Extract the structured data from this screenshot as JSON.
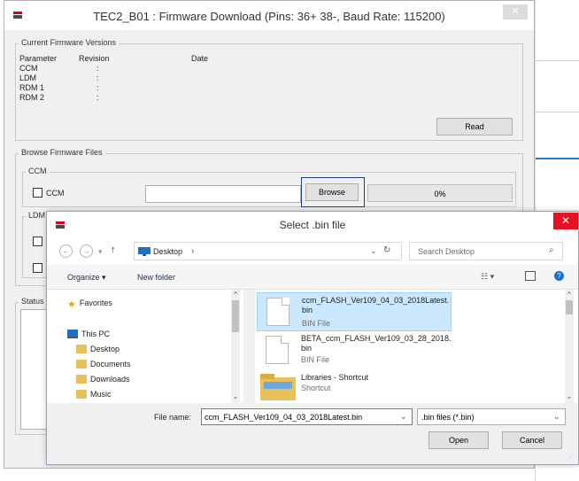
{
  "main_window": {
    "title": "TEC2_B01 : Firmware Download (Pins: 36+ 38-, Baud Rate: 115200)",
    "current_versions": {
      "legend": "Current Firmware Versions",
      "header": {
        "parameter": "Parameter",
        "revision": "Revision",
        "date": "Date"
      },
      "rows": [
        {
          "name": "CCM",
          "sep": ":"
        },
        {
          "name": "LDM",
          "sep": ":"
        },
        {
          "name": "RDM 1",
          "sep": ":"
        },
        {
          "name": "RDM 2",
          "sep": ":"
        }
      ],
      "read_button": "Read"
    },
    "browse": {
      "legend": "Browse Firmware Files",
      "ccm_legend": "CCM",
      "ccm_checkbox_label": "CCM",
      "browse_button": "Browse",
      "progress_text": "0%",
      "progress_fraction": 0,
      "ldm_legend": "LDM"
    },
    "status_legend": "Status"
  },
  "file_dialog": {
    "title": "Select .bin file",
    "close_glyph": "✕",
    "breadcrumb": "Desktop",
    "breadcrumb_sep": "›",
    "search_placeholder": "Search Desktop",
    "toolbar": {
      "organize": "Organize ▾",
      "new_folder": "New folder"
    },
    "nav_items": [
      {
        "label": "Favorites",
        "icon": "star-icon"
      },
      {
        "label": "This PC",
        "icon": "pc-icon"
      },
      {
        "label": "Desktop",
        "icon": "desktop-folder-icon"
      },
      {
        "label": "Documents",
        "icon": "documents-folder-icon"
      },
      {
        "label": "Downloads",
        "icon": "downloads-folder-icon"
      },
      {
        "label": "Music",
        "icon": "music-folder-icon"
      }
    ],
    "files": [
      {
        "name": "ccm_FLASH_Ver109_04_03_2018Latest.bin",
        "type": "BIN File",
        "selected": true
      },
      {
        "name": "BETA_ccm_FLASH_Ver109_03_28_2018.bin",
        "type": "BIN File",
        "selected": false
      },
      {
        "name": "Libraries - Shortcut",
        "type": "Shortcut",
        "selected": false
      }
    ],
    "filename_label": "File name:",
    "filename_value": "ccm_FLASH_Ver109_04_03_2018Latest.bin",
    "filter_value": ".bin files (*.bin)",
    "open_button": "Open",
    "cancel_button": "Cancel"
  },
  "colors": {
    "selection_bg": "#cce8ff",
    "close_red": "#e81123",
    "focus_border": "#1f3d8a"
  }
}
